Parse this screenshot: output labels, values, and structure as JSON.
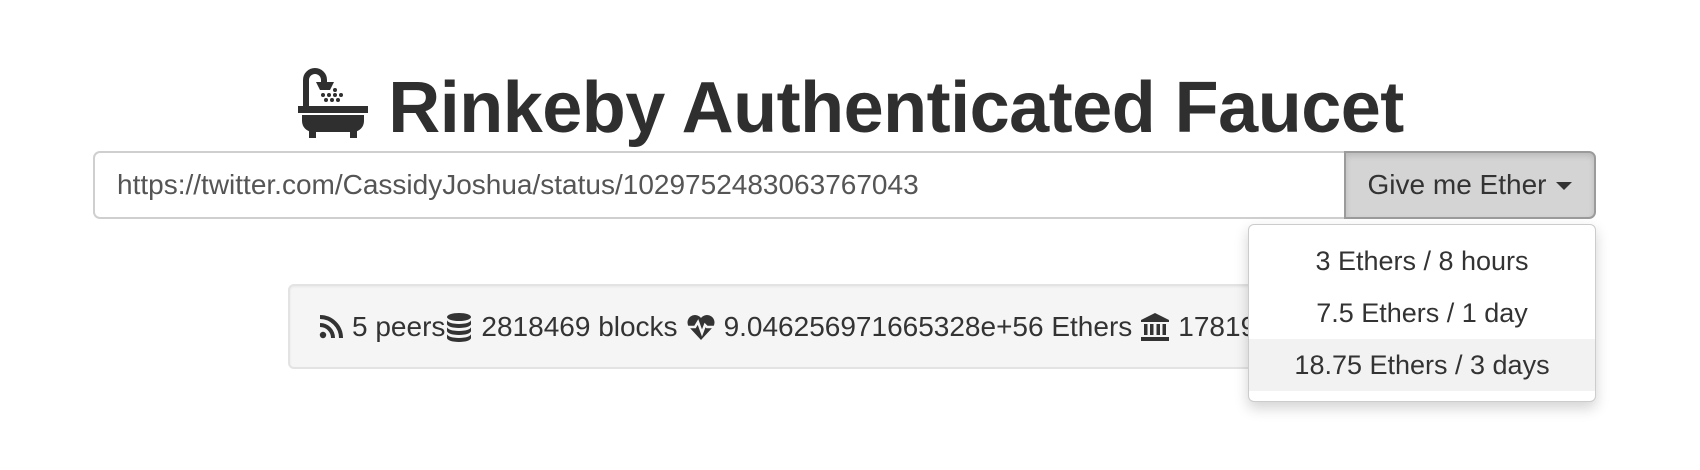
{
  "header": {
    "title": "Rinkeby Authenticated Faucet",
    "icon": "bathtub-icon"
  },
  "request_form": {
    "url_value": "https://twitter.com/CassidyJoshua/status/1029752483063767043",
    "button_label": "Give me Ether",
    "button_icon": "caret-down-icon"
  },
  "dropdown": {
    "items": [
      {
        "label": "3 Ethers / 8 hours"
      },
      {
        "label": "7.5 Ethers / 1 day"
      },
      {
        "label": "18.75 Ethers / 3 days",
        "highlighted": true
      }
    ]
  },
  "stats": {
    "peers": "5 peers",
    "peers_icon": "rss-icon",
    "blocks": "2818469 blocks",
    "blocks_icon": "database-icon",
    "funds": "9.046256971665328e+56 Ethers",
    "funds_icon": "heartbeat-icon",
    "requests_partial": "17819",
    "requests_icon": "bank-icon"
  },
  "colors": {
    "text": "#333333",
    "button_bg": "#d4d4d4",
    "well_bg": "#f5f5f5",
    "menu_highlight": "#f2f2f2"
  }
}
